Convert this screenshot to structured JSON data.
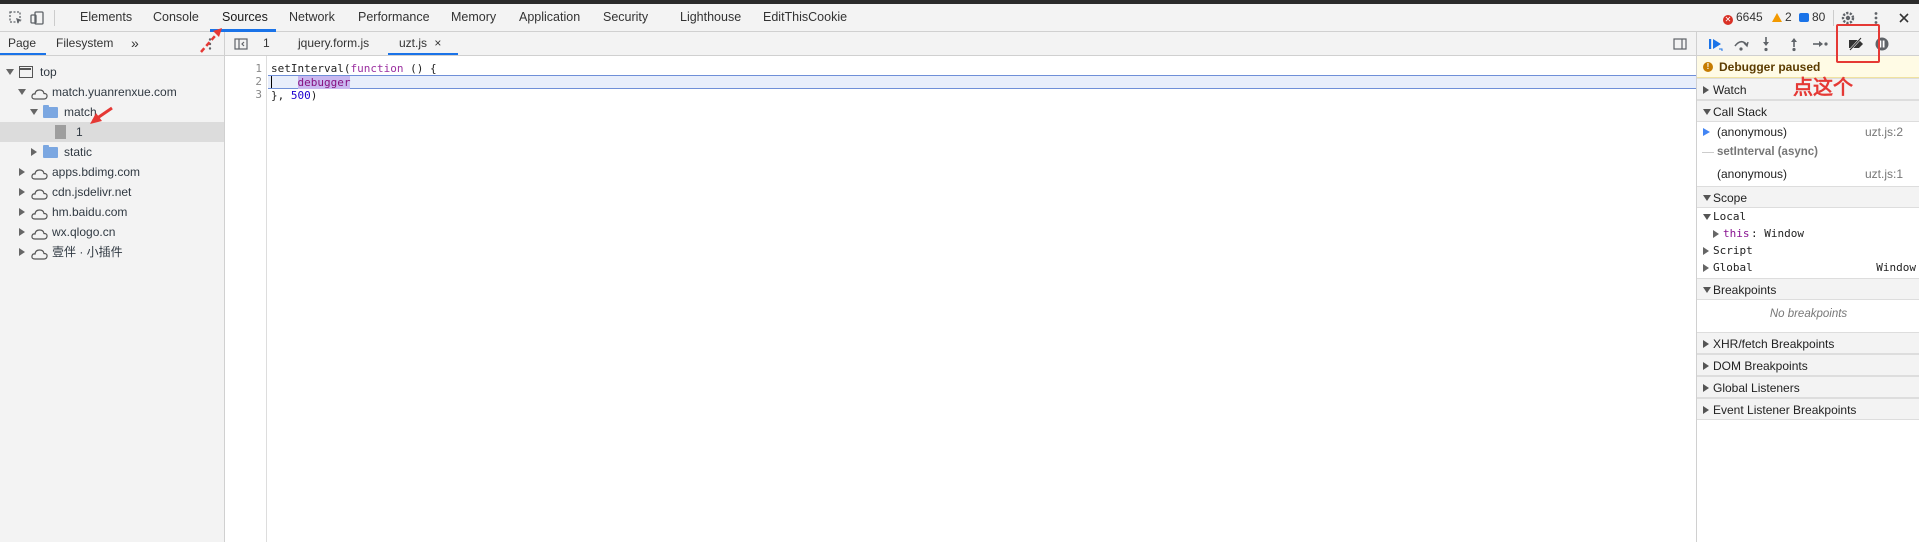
{
  "toolbar": {
    "tabs": [
      "Elements",
      "Console",
      "Sources",
      "Network",
      "Performance",
      "Memory",
      "Application",
      "Security",
      "Lighthouse",
      "EditThisCookie"
    ],
    "active_tab": "Sources",
    "errors": "6645",
    "warnings": "2",
    "messages": "80"
  },
  "navigator": {
    "tabs": [
      "Page",
      "Filesystem"
    ],
    "more": "»",
    "tree": [
      {
        "label": "top",
        "type": "frame",
        "depth": 0,
        "expanded": true
      },
      {
        "label": "match.yuanrenxue.com",
        "type": "domain",
        "depth": 1,
        "expanded": true
      },
      {
        "label": "match",
        "type": "folder",
        "depth": 2,
        "expanded": true
      },
      {
        "label": "1",
        "type": "file",
        "depth": 3,
        "selected": true
      },
      {
        "label": "static",
        "type": "folder",
        "depth": 2,
        "expanded": false
      },
      {
        "label": "apps.bdimg.com",
        "type": "domain",
        "depth": 1,
        "expanded": false
      },
      {
        "label": "cdn.jsdelivr.net",
        "type": "domain",
        "depth": 1,
        "expanded": false
      },
      {
        "label": "hm.baidu.com",
        "type": "domain",
        "depth": 1,
        "expanded": false
      },
      {
        "label": "wx.qlogo.cn",
        "type": "domain",
        "depth": 1,
        "expanded": false
      },
      {
        "label": "壹伴 · 小插件",
        "type": "domain",
        "depth": 1,
        "expanded": false
      }
    ]
  },
  "editor": {
    "tabs": [
      {
        "label": "1",
        "active": false,
        "closable": false
      },
      {
        "label": "jquery.form.js",
        "active": false,
        "closable": false
      },
      {
        "label": "uzt.js",
        "active": true,
        "closable": true
      }
    ],
    "close_glyph": "×",
    "line_numbers": [
      "1",
      "2",
      "3"
    ],
    "code": {
      "l1_a": "setInterval(",
      "l1_kw": "function",
      "l1_b": " () {",
      "l2_indent": "    ",
      "l2_dbg": "debugger",
      "l3_a": "}, ",
      "l3_num": "500",
      "l3_b": ")"
    }
  },
  "debugger": {
    "paused_text": "Debugger paused",
    "sections": {
      "watch": "Watch",
      "call_stack": "Call Stack",
      "scope": "Scope",
      "breakpoints": "Breakpoints",
      "xhr": "XHR/fetch Breakpoints",
      "dom": "DOM Breakpoints",
      "global_listeners": "Global Listeners",
      "event_listeners": "Event Listener Breakpoints"
    },
    "call_stack": [
      {
        "name": "(anonymous)",
        "loc": "uzt.js:2",
        "current": true
      },
      {
        "name": "(anonymous)",
        "loc": "uzt.js:1",
        "current": false
      }
    ],
    "async_label": "setInterval (async)",
    "scope": {
      "local": "Local",
      "this_key": "this",
      "this_val": ": Window",
      "script": "Script",
      "global": "Global",
      "global_val": "Window"
    },
    "no_breakpoints": "No breakpoints"
  },
  "annotation": {
    "text": "点这个",
    "color": "#e53935"
  },
  "colors": {
    "accent": "#1a73e8",
    "annotation": "#e53935"
  }
}
